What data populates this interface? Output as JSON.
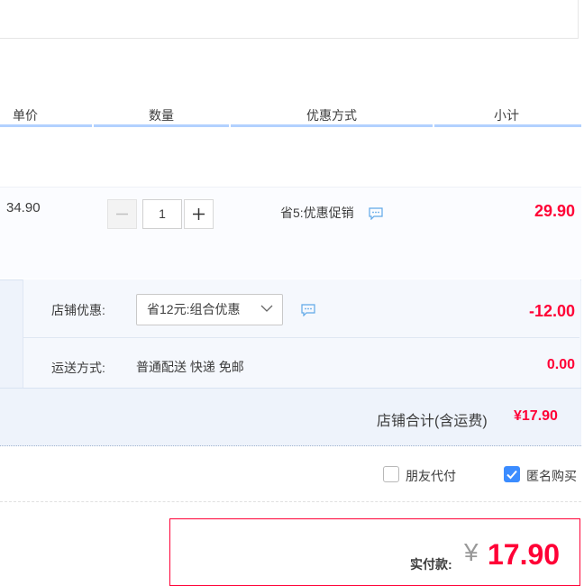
{
  "table_header": {
    "unit_price": "单价",
    "quantity": "数量",
    "promotion": "优惠方式",
    "subtotal": "小计"
  },
  "item": {
    "unit_price": "34.90",
    "quantity": "1",
    "promotion": "省5:优惠促销",
    "subtotal": "29.90"
  },
  "shop": {
    "discount_label": "店铺优惠:",
    "discount_select": "省12元:组合优惠",
    "discount_amount": "-12.00",
    "shipping_label": "运送方式:",
    "shipping_value": "普通配送 快递 免邮",
    "shipping_fee": "0.00",
    "total_label": "店铺合计(含运费)",
    "total_value": "¥17.90"
  },
  "options": {
    "friend_pay": {
      "label": "朋友代付",
      "checked": false
    },
    "anonymous": {
      "label": "匿名购买",
      "checked": true
    }
  },
  "payment": {
    "label": "实付款:",
    "currency": "¥",
    "amount": "17.90"
  },
  "colors": {
    "accent_red": "#ff0036",
    "header_line": "#b2d1ff",
    "checkbox_blue": "#3b8cff"
  }
}
